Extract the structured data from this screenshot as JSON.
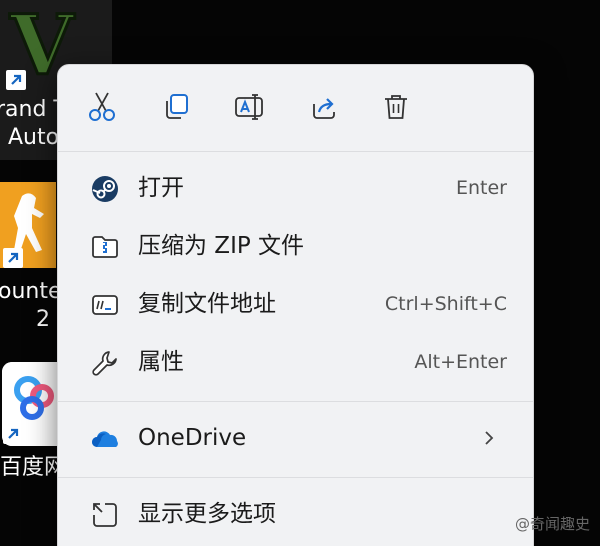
{
  "desktop": {
    "icons": [
      {
        "line1": "rand T",
        "line2": "Auto"
      },
      {
        "line1": "ounter",
        "line2": "2"
      },
      {
        "line1": "百度网"
      }
    ],
    "gta_logo_letter": "V"
  },
  "menu": {
    "quick_actions": [
      {
        "name": "cut-icon"
      },
      {
        "name": "copy-icon"
      },
      {
        "name": "rename-icon"
      },
      {
        "name": "share-icon"
      },
      {
        "name": "delete-icon"
      }
    ],
    "items": [
      {
        "icon": "steam-icon",
        "label": "打开",
        "shortcut": "Enter"
      },
      {
        "icon": "zip-folder-icon",
        "label": "压缩为 ZIP 文件",
        "shortcut": ""
      },
      {
        "icon": "copy-path-icon",
        "label": "复制文件地址",
        "shortcut": "Ctrl+Shift+C"
      },
      {
        "icon": "wrench-icon",
        "label": "属性",
        "shortcut": "Alt+Enter"
      },
      {
        "icon": "onedrive-icon",
        "label": "OneDrive",
        "shortcut": ""
      },
      {
        "icon": "more-options-icon",
        "label": "显示更多选项",
        "shortcut": ""
      }
    ]
  },
  "watermark": "@奇闻趣史"
}
